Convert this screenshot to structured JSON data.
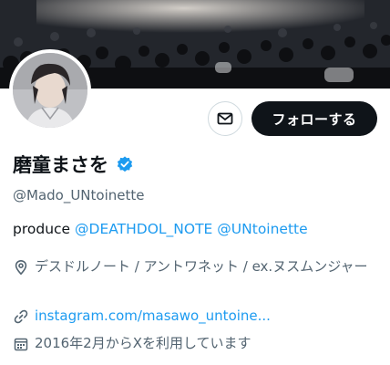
{
  "profile": {
    "display_name": "磨童まさを",
    "handle": "@Mado_UNtoinette",
    "verified_icon": "verified-badge-icon",
    "bio": {
      "prefix": "produce ",
      "mention_1": "@DEATHDOL_NOTE",
      "separator": " ",
      "mention_2": "@UNtoinette"
    },
    "location": "デスドルノート / アントワネット / ex.ヌスムンジャー",
    "website": "instagram.com/masawo_untoine...",
    "joined": "2016年2月からXを利用しています"
  },
  "actions": {
    "message_icon": "mail-icon",
    "follow_label": "フォローする"
  },
  "colors": {
    "accent": "#1d9bf0",
    "text_primary": "#0f1419",
    "text_secondary": "#536471",
    "follow_button_bg": "#0f1419",
    "border": "#cfd9de"
  }
}
